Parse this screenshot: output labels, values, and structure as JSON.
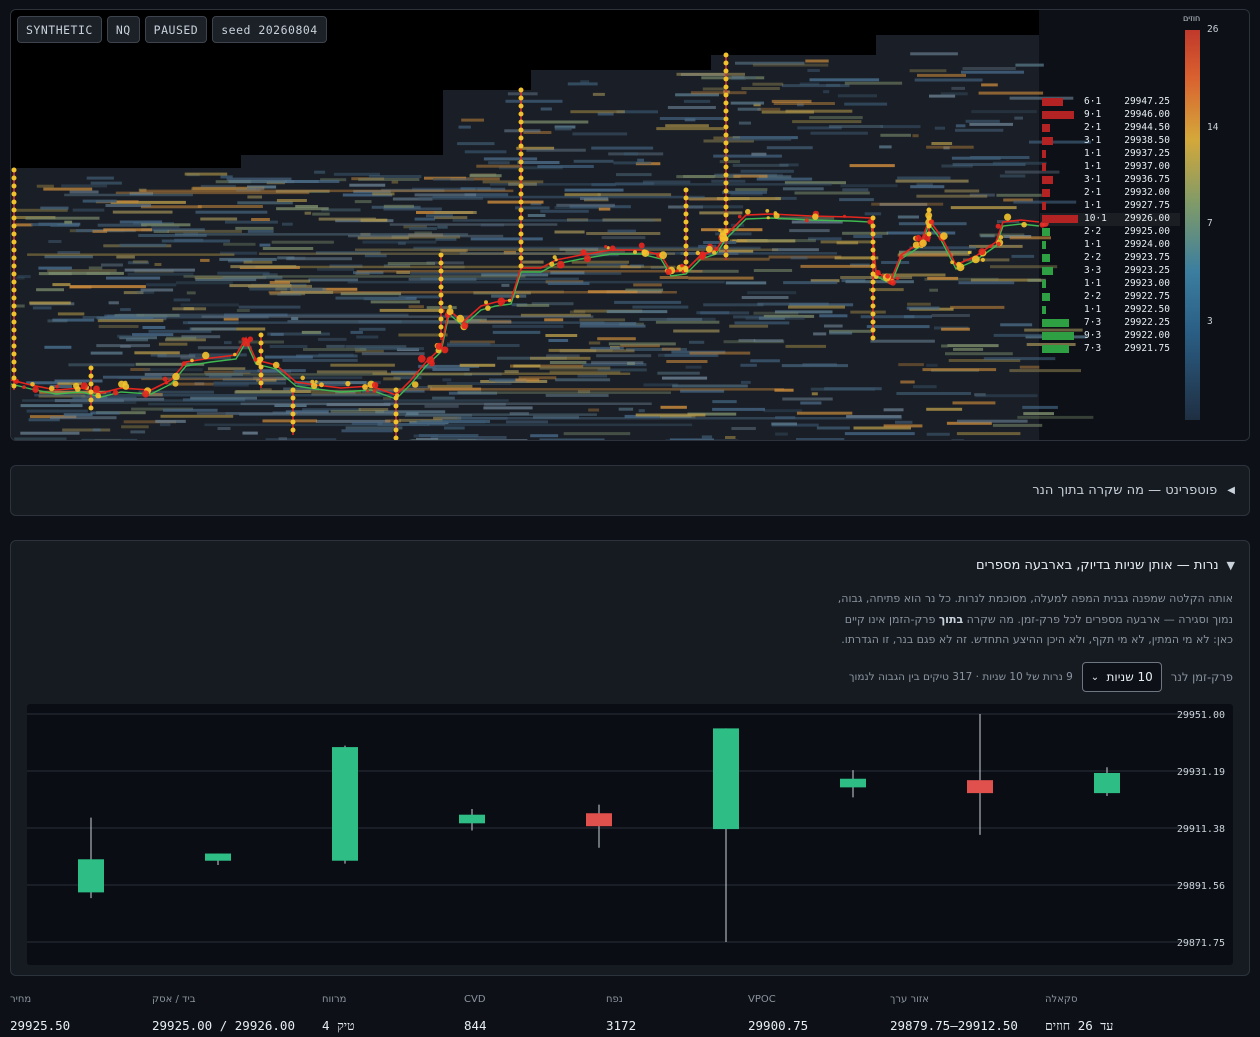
{
  "header_chips": [
    {
      "label": "SYNTHETIC"
    },
    {
      "label": "NQ"
    },
    {
      "label": "PAUSED"
    },
    {
      "label": "seed 20260804"
    }
  ],
  "order_book": [
    {
      "size": "6·1",
      "price": "29947.25",
      "side": "ask",
      "fill": 0.55
    },
    {
      "size": "9·1",
      "price": "29946.00",
      "side": "ask",
      "fill": 0.85
    },
    {
      "size": "2·1",
      "price": "29944.50",
      "side": "ask",
      "fill": 0.2
    },
    {
      "size": "3·1",
      "price": "29938.50",
      "side": "ask",
      "fill": 0.3
    },
    {
      "size": "1·1",
      "price": "29937.25",
      "side": "ask",
      "fill": 0.1
    },
    {
      "size": "1·1",
      "price": "29937.00",
      "side": "ask",
      "fill": 0.1
    },
    {
      "size": "3·1",
      "price": "29936.75",
      "side": "ask",
      "fill": 0.3
    },
    {
      "size": "2·1",
      "price": "29932.00",
      "side": "ask",
      "fill": 0.2
    },
    {
      "size": "1·1",
      "price": "29927.75",
      "side": "ask",
      "fill": 0.1
    },
    {
      "size": "10·1",
      "price": "29926.00",
      "side": "ask",
      "fill": 0.95,
      "highlight": true
    },
    {
      "size": "2·2",
      "price": "29925.00",
      "side": "bid",
      "fill": 0.2
    },
    {
      "size": "1·1",
      "price": "29924.00",
      "side": "bid",
      "fill": 0.1
    },
    {
      "size": "2·2",
      "price": "29923.75",
      "side": "bid",
      "fill": 0.2
    },
    {
      "size": "3·3",
      "price": "29923.25",
      "side": "bid",
      "fill": 0.3
    },
    {
      "size": "1·1",
      "price": "29923.00",
      "side": "bid",
      "fill": 0.1
    },
    {
      "size": "2·2",
      "price": "29922.75",
      "side": "bid",
      "fill": 0.2
    },
    {
      "size": "1·1",
      "price": "29922.50",
      "side": "bid",
      "fill": 0.1
    },
    {
      "size": "7·3",
      "price": "29922.25",
      "side": "bid",
      "fill": 0.7
    },
    {
      "size": "9·3",
      "price": "29922.00",
      "side": "bid",
      "fill": 0.85
    },
    {
      "size": "7·3",
      "price": "29921.75",
      "side": "bid",
      "fill": 0.7
    }
  ],
  "legend": {
    "title": "חוזים",
    "ticks": [
      "26",
      "14",
      "7",
      "3"
    ]
  },
  "footprint": {
    "arrow": "◀",
    "title": "פוטפרינט — מה שקרה בתוך הנר"
  },
  "candles_section": {
    "arrow": "▼",
    "title": "נרות — אותן שניות בדיוק, בארבעה מספרים",
    "desc_part1": "אותה הקלטה שמפנה גבנית המפה למעלה, מסוכמת לנרות. כל נר הוא פתיחה, גבוה, נמוך וסגירה — ארבעה מספרים לכל פרק-זמן. מה שקרה ",
    "desc_bold": "בתוך",
    "desc_part2": " פרק-הזמן אינו קיים כאן: לא מי המתין, לא מי תקף, ולא היכן ההיצע התחדש. זה לא פגם בנר, זו הגדרתו.",
    "period_label": "פרק-זמן לנר",
    "period_value": "10 שניות",
    "info": "9 נרות של 10 שניות · 317 טיקים בין הגבוה לנמוך"
  },
  "chart_data": {
    "type": "candlestick",
    "y_ticks": [
      "29951.00",
      "29931.19",
      "29911.38",
      "29891.56",
      "29871.75"
    ],
    "ylim": [
      29871.75,
      29951.0
    ],
    "candles": [
      {
        "open": 29889.0,
        "high": 29915.0,
        "low": 29887.0,
        "close": 29900.5
      },
      {
        "open": 29900.0,
        "high": 29902.5,
        "low": 29898.5,
        "close": 29902.5
      },
      {
        "open": 29900.0,
        "high": 29940.0,
        "low": 29899.0,
        "close": 29939.5
      },
      {
        "open": 29913.0,
        "high": 29918.0,
        "low": 29910.5,
        "close": 29916.0
      },
      {
        "open": 29916.5,
        "high": 29919.5,
        "low": 29904.5,
        "close": 29912.0
      },
      {
        "open": 29911.0,
        "high": 29946.0,
        "low": 29871.75,
        "close": 29946.0
      },
      {
        "open": 29925.5,
        "high": 29931.5,
        "low": 29922.0,
        "close": 29928.5
      },
      {
        "open": 29928.0,
        "high": 29951.0,
        "low": 29909.0,
        "close": 29923.5
      },
      {
        "open": 29923.5,
        "high": 29932.5,
        "low": 29922.5,
        "close": 29930.5
      }
    ],
    "up_color": "#2ebd85",
    "down_color": "#e0504d",
    "grid": true
  },
  "stats": [
    {
      "label": "מחיר",
      "value": "29925.50"
    },
    {
      "label": "ביד / אסק",
      "value": "29925.00 / 29926.00"
    },
    {
      "label": "מרווח",
      "value": "4 טיק"
    },
    {
      "label": "CVD",
      "value": "844"
    },
    {
      "label": "נפח",
      "value": "3172"
    },
    {
      "label": "VPOC",
      "value": "29900.75"
    },
    {
      "label": "אזור ערך",
      "value": "29879.75–29912.50"
    },
    {
      "label": "סקאלה",
      "value": "עד 26 חוזים"
    }
  ],
  "colors": {
    "bid": "#2ea043",
    "ask": "#b42323",
    "price_line_red": "#e5261f",
    "price_line_green": "#3fb950",
    "trade_dot": "#f2c12e"
  }
}
